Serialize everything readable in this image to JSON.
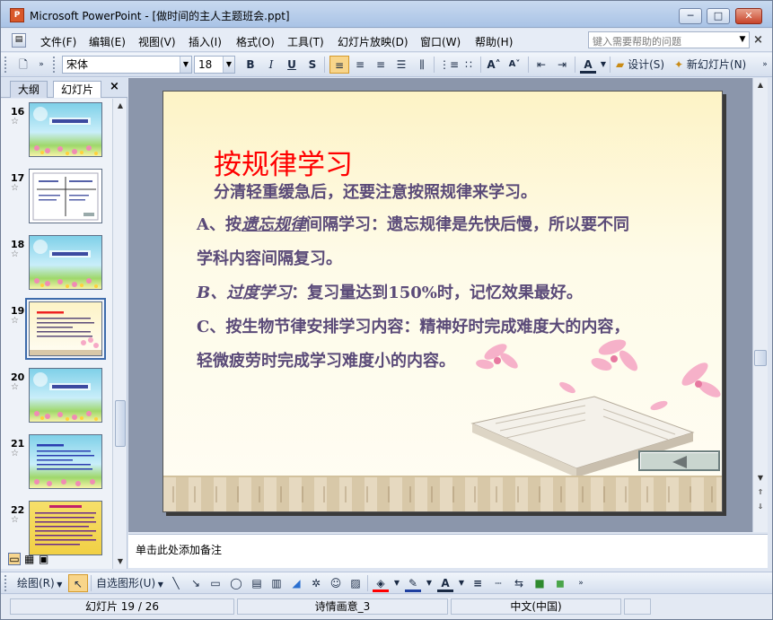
{
  "window": {
    "app_icon": "powerpoint-icon",
    "title": "Microsoft PowerPoint - [做时间的主人主题班会.ppt]",
    "min_glyph": "─",
    "max_glyph": "□",
    "close_glyph": "✕"
  },
  "menu": {
    "items": [
      "文件(F)",
      "编辑(E)",
      "视图(V)",
      "插入(I)",
      "格式(O)",
      "工具(T)",
      "幻灯片放映(D)",
      "窗口(W)",
      "帮助(H)"
    ],
    "help_placeholder": "键入需要帮助的问题",
    "close_doc": "×"
  },
  "toolbar": {
    "font_name": "宋体",
    "font_size": "18",
    "bold": "B",
    "italic": "I",
    "underline": "U",
    "shadow": "S",
    "design_label": "设计(S)",
    "new_slide_label": "新幻灯片(N)"
  },
  "left_pane": {
    "tab_outline": "大纲",
    "tab_slides": "幻灯片",
    "close": "×",
    "thumbnails": [
      {
        "num": "16",
        "selected": false
      },
      {
        "num": "17",
        "selected": false
      },
      {
        "num": "18",
        "selected": false
      },
      {
        "num": "19",
        "selected": true
      },
      {
        "num": "20",
        "selected": false
      },
      {
        "num": "21",
        "selected": false
      },
      {
        "num": "22",
        "selected": false
      }
    ],
    "star": "☆"
  },
  "slide": {
    "title": "按规律学习",
    "line1": "分清轻重缓急后，还要注意按照规律来学习。",
    "line2_a": "A、按",
    "line2_b": "遗忘规律",
    "line2_c": "间隔学习：遗忘规律是先快后慢，所以要不同",
    "line3": "学科内容间隔复习。",
    "line4_a": "B、",
    "line4_b": "过度学习",
    "line4_c": "：复习量达到150%时，记忆效果最好。",
    "line5": "C、按生物节律安排学习内容：精神好时完成难度大的内容，",
    "line6": "轻微疲劳时完成学习难度小的内容。"
  },
  "notes": {
    "placeholder": "单击此处添加备注"
  },
  "drawbar": {
    "draw_label": "绘图(R)",
    "autoshape_label": "自选图形(U)"
  },
  "status": {
    "slide_pos": "幻灯片 19 / 26",
    "design": "诗情画意_3",
    "language": "中文(中国)"
  },
  "colors": {
    "title_red": "#ff0000",
    "body_purple": "#5a4a78",
    "accent_blue": "#3d6bab"
  }
}
